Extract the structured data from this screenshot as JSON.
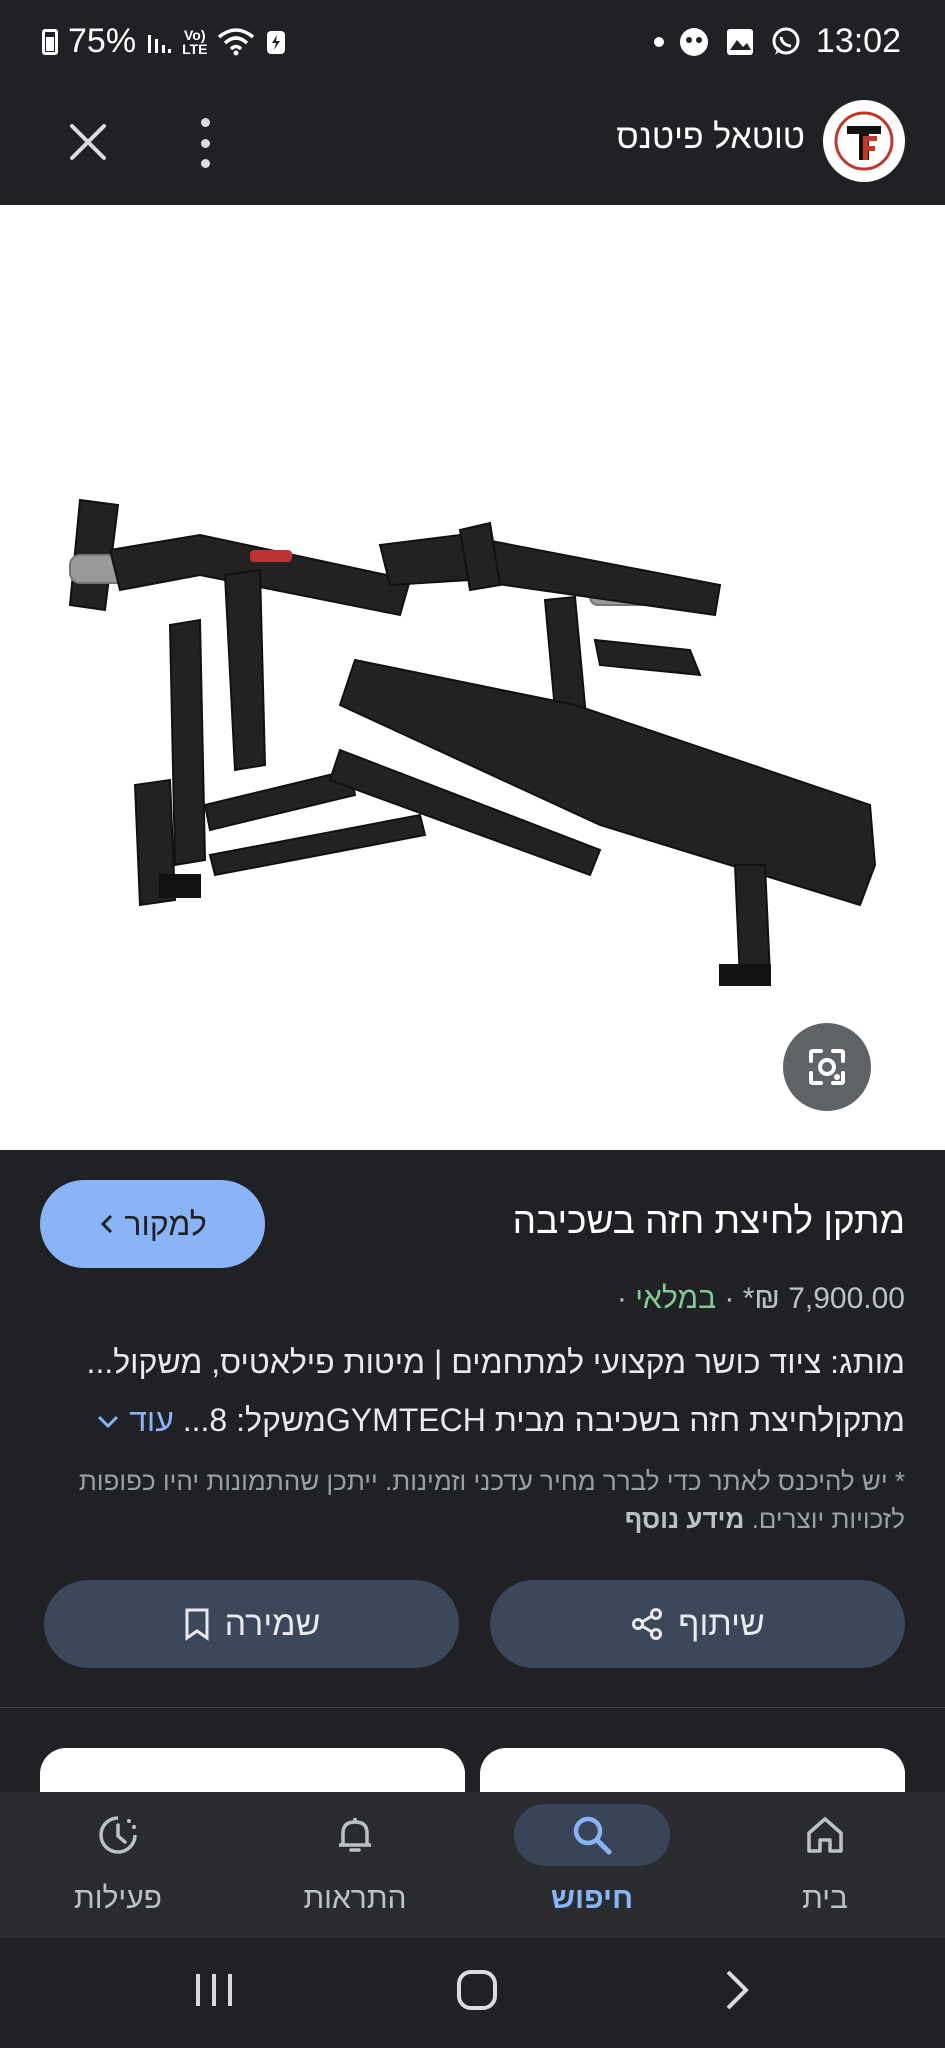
{
  "status_bar": {
    "battery": "75%",
    "network": "LTE",
    "network_top": "Vo)",
    "time": "13:02"
  },
  "top_bar": {
    "site_title": "טוטאל פיטנס"
  },
  "product": {
    "title": "מתקן לחיצת חזה בשכיבה",
    "source_button": "למקור",
    "price": "7,900.00 ₪*",
    "separator": "·",
    "stock": "במלאי",
    "description_line1": "מותג: ציוד כושר מקצועי למתחמים | מיטות פילאטיס, משקול...",
    "description_line2": "מתקןלחיצת חזה בשכיבה מבית GYMTECHמשקל: 8...",
    "more_link": "עוד",
    "disclaimer": "* יש להיכנס לאתר כדי לברר מחיר עדכני וזמינות. ייתכן שהתמונות יהיו כפופות לזכויות יוצרים.",
    "disclaimer_link": "מידע נוסף"
  },
  "actions": {
    "share": "שיתוף",
    "save": "שמירה"
  },
  "bottom_nav": {
    "home": "בית",
    "search": "חיפוש",
    "notifications": "התראות",
    "activity": "פעילות"
  },
  "colors": {
    "background": "#202124",
    "accent": "#8ab4f8",
    "stock_green": "#81c995",
    "button_bg": "#3c4759"
  },
  "icons": [
    "battery-icon",
    "signal-icon",
    "wifi-icon",
    "close-icon",
    "more-vert-icon",
    "lens-icon",
    "share-icon",
    "bookmark-icon",
    "home-icon",
    "search-icon",
    "bell-icon",
    "history-icon"
  ]
}
